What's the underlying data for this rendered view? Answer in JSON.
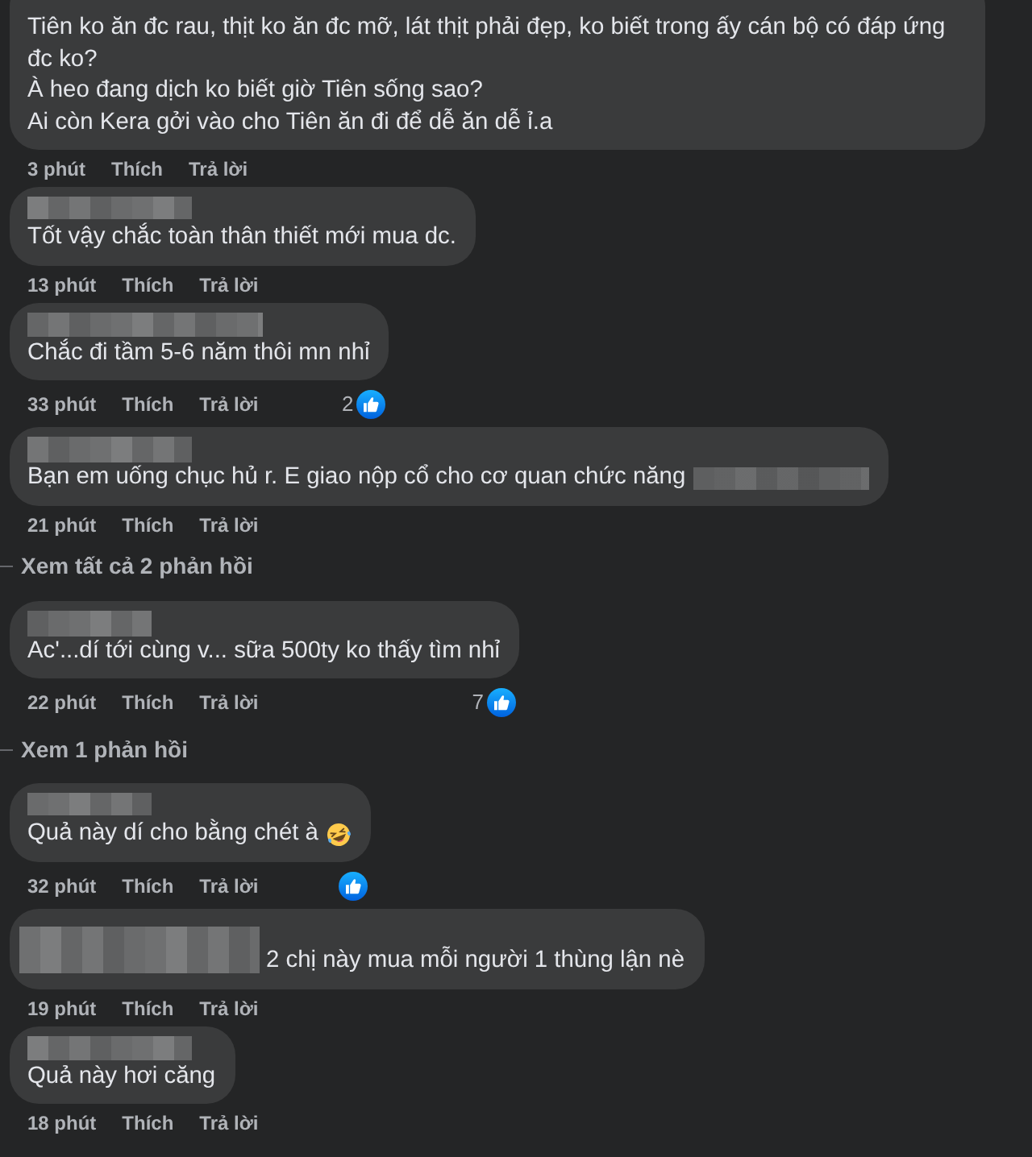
{
  "thread": [
    {
      "kind": "comment",
      "text": "Tiên ko ăn đc rau, thịt ko ăn đc mỡ, lát thịt phải đẹp, ko biết trong ấy cán bộ có đáp ứng đc ko?\nÀ heo đang dịch ko biết giờ Tiên sống sao?\nAi còn Kera gởi vào cho Tiên ăn đi để dễ ăn dễ ỉ.a",
      "time": "3 phút",
      "actions": [
        "Thích",
        "Trả lời"
      ]
    },
    {
      "kind": "comment",
      "name_hidden": true,
      "text": "Tốt vậy chắc toàn thân thiết mới mua dc.",
      "time": "13 phút",
      "actions": [
        "Thích",
        "Trả lời"
      ]
    },
    {
      "kind": "comment",
      "name_hidden": true,
      "text": "Chắc đi tầm 5-6 năm thôi mn nhỉ",
      "time": "33 phút",
      "actions": [
        "Thích",
        "Trả lời"
      ],
      "liked": true,
      "like_count": "2"
    },
    {
      "kind": "comment",
      "name_hidden": true,
      "text_end_hidden": true,
      "text": "Bạn em uống chục hủ r. E giao nộp cổ cho cơ quan chức năng",
      "time": "21 phút",
      "actions": [
        "Thích",
        "Trả lời"
      ]
    },
    {
      "kind": "replies_link",
      "label": "Xem tất cả 2 phản hồi"
    },
    {
      "kind": "comment",
      "name_hidden": true,
      "text": "Ac'...dí tới cùng v... sữa 500ty ko thấy tìm nhỉ",
      "time": "22 phút",
      "actions": [
        "Thích",
        "Trả lời"
      ],
      "liked": true,
      "like_count": "7"
    },
    {
      "kind": "replies_link",
      "label": "Xem 1 phản hồi"
    },
    {
      "kind": "comment",
      "name_hidden": true,
      "text": "Quả này dí cho bằng chét à",
      "emoji_after": true,
      "time": "32 phút",
      "actions": [
        "Thích",
        "Trả lời"
      ],
      "liked": true
    },
    {
      "kind": "comment",
      "name_hidden": true,
      "text_start_hidden": true,
      "text": "2 chị này mua mỗi người 1 thùng lận nè",
      "time": "19 phút",
      "actions": [
        "Thích",
        "Trả lời"
      ]
    },
    {
      "kind": "comment",
      "name_hidden": true,
      "text": "Quả này hơi căng",
      "time": "18 phút",
      "actions": [
        "Thích",
        "Trả lời"
      ]
    }
  ]
}
